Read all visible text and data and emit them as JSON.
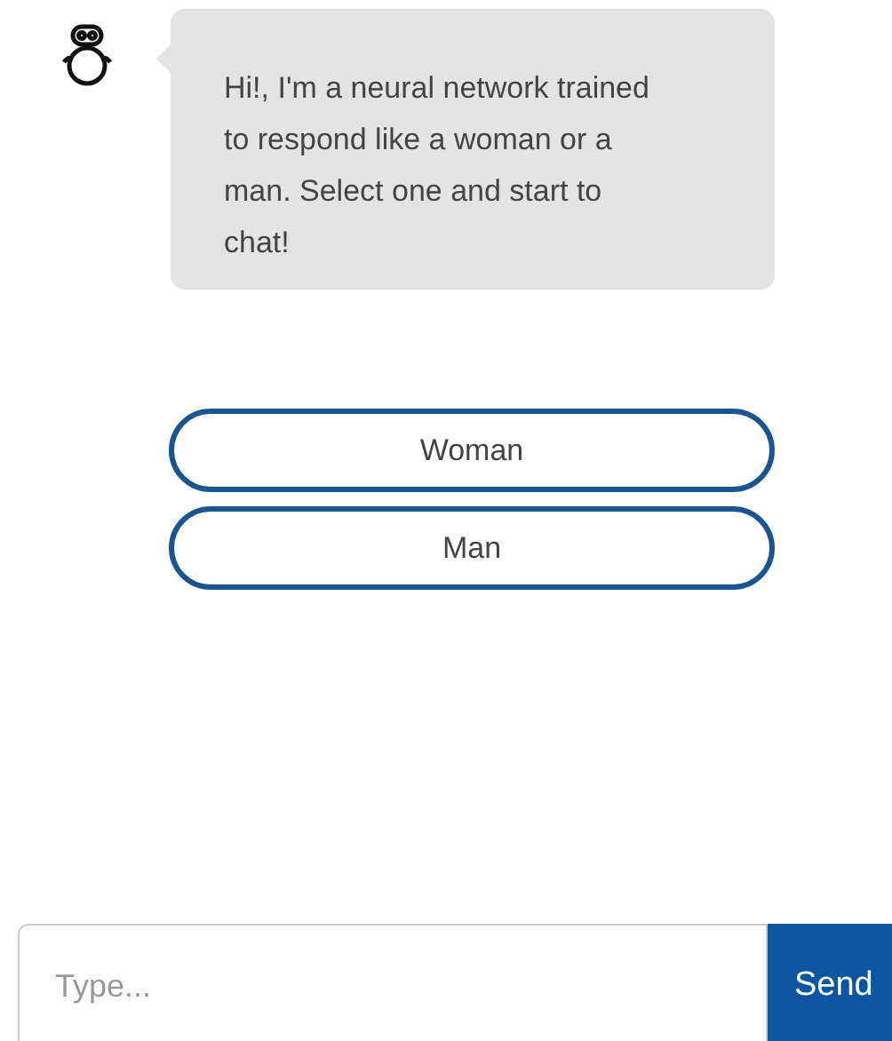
{
  "message": {
    "text": "Hi!, I'm a neural network trained to respond like a woman or a man. Select one and start to chat!"
  },
  "choices": [
    {
      "label": "Woman"
    },
    {
      "label": "Man"
    }
  ],
  "composer": {
    "placeholder": "Type...",
    "send": "Send"
  }
}
